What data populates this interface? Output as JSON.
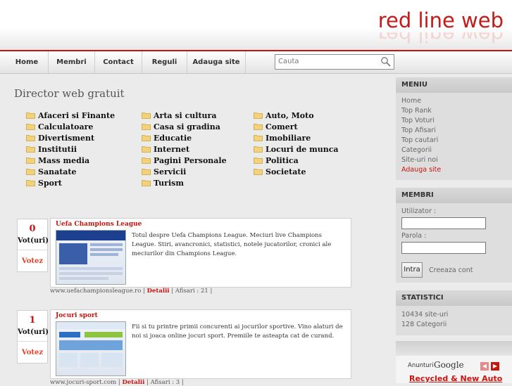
{
  "header": {
    "logo": "red line web"
  },
  "nav": {
    "items": [
      "Home",
      "Membri",
      "Contact",
      "Reguli",
      "Adauga site"
    ],
    "search_placeholder": "Cauta"
  },
  "main": {
    "title": "Director web gratuit",
    "categories": [
      [
        "Afaceri si Finante",
        "Calculatoare",
        "Divertisment",
        "Institutii",
        "Mass media",
        "Sanatate",
        "Sport"
      ],
      [
        "Arta si cultura",
        "Casa si gradina",
        "Educatie",
        "Internet",
        "Pagini Personale",
        "Servicii",
        "Turism"
      ],
      [
        "Auto, Moto",
        "Comert",
        "Imobiliare",
        "Locuri de munca",
        "Politica",
        "Societate"
      ]
    ],
    "listings": [
      {
        "votes": "0",
        "votes_label": "Vot(uri)",
        "vote_button": "Votez",
        "title": "Uefa Champions League",
        "description": "Totul despre Uefa Champions League. Meciuri live Champions League. Stiri, avancronici, statistici, notele jucatorilor, cronici ale meciurilor din Champions League.",
        "url": "www.uefachampionsleague.ro",
        "details": "Detalii",
        "views": "Afisari : 21"
      },
      {
        "votes": "1",
        "votes_label": "Vot(uri)",
        "vote_button": "Votez",
        "title": "Jocuri sport",
        "description": "Fii si tu printre primii concurenti ai jocurilor sportive. Vino alaturi de noi si joaca online jocuri sport. Premiile te asteapta cat de curand.",
        "url": "www.jocuri-sport.com",
        "details": "Detalii",
        "views": "Afisari : 3"
      }
    ]
  },
  "sidebar": {
    "menu": {
      "title": "MENIU",
      "items": [
        "Home",
        "Top Rank",
        "Top Voturi",
        "Top Afisari",
        "Top cautari",
        "Categorii",
        "Site-uri noi",
        "Adauga site"
      ]
    },
    "members": {
      "title": "MEMBRI",
      "user_label": "Utilizator :",
      "pass_label": "Parola :",
      "login_button": "Intra",
      "create_account": "Creeaza cont"
    },
    "stats": {
      "title": "STATISTICI",
      "sites": "10434 site-uri",
      "categories": "128 Categorii"
    },
    "ads": {
      "label": "Anunturi",
      "brand": "Google",
      "link": "Recycled & New Auto"
    }
  },
  "colors": {
    "accent": "#c8140f",
    "background": "#ebebeb"
  }
}
